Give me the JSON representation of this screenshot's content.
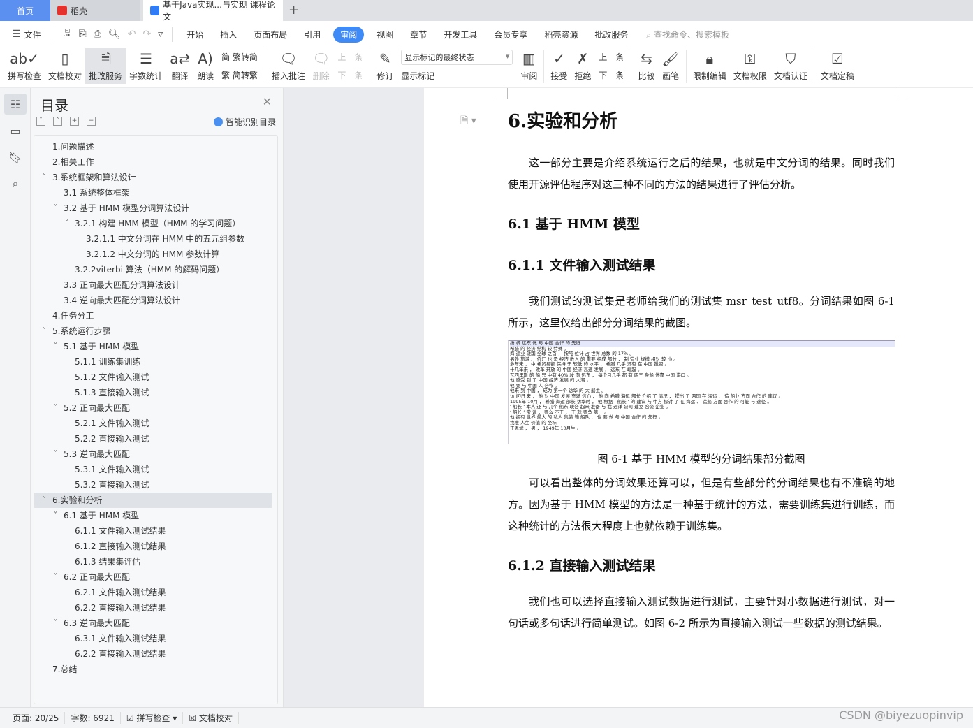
{
  "tabs": [
    {
      "label": "首页"
    },
    {
      "label": "稻壳"
    },
    {
      "label": "基于Java实现...与实现 课程论文"
    }
  ],
  "menu": {
    "file": "文件",
    "items": [
      "开始",
      "插入",
      "页面布局",
      "引用",
      "审阅",
      "视图",
      "章节",
      "开发工具",
      "会员专享",
      "稻壳资源",
      "批改服务"
    ],
    "active": "审阅",
    "search_placeholder": "查找命令、搜索模板"
  },
  "toolbar": {
    "spell": "拼写检查",
    "proof": "文档校对",
    "grade": "批改服务",
    "wordcount": "字数统计",
    "translate": "翻译",
    "read": "朗读",
    "t2s": "繁转简",
    "s2t": "简转繁",
    "insert_comment": "插入批注",
    "delete": "删除",
    "prev": "上一条",
    "next": "下一条",
    "track": "修订",
    "markup_state": "显示标记的最终状态",
    "show_markup": "显示标记",
    "review": "审阅",
    "accept": "接受",
    "reject": "拒绝",
    "prev2": "上一条",
    "next2": "下一条",
    "compare": "比较",
    "pen": "画笔",
    "restrict": "限制编辑",
    "permission": "文档权限",
    "certify": "文档认证",
    "finalize": "文档定稿"
  },
  "toc": {
    "title": "目录",
    "smart": "智能识别目录",
    "items": [
      {
        "label": "1.问题描述",
        "level": 1,
        "chev": false
      },
      {
        "label": "2.相关工作",
        "level": 1,
        "chev": false
      },
      {
        "label": "3.系统框架和算法设计",
        "level": 1,
        "chev": true
      },
      {
        "label": "3.1 系统整体框架",
        "level": 2,
        "chev": false
      },
      {
        "label": "3.2 基于 HMM 模型分词算法设计",
        "level": 2,
        "chev": true
      },
      {
        "label": "3.2.1 构建 HMM 模型（HMM 的学习问题）",
        "level": 3,
        "chev": true
      },
      {
        "label": "3.2.1.1 中文分词在 HMM 中的五元组参数",
        "level": 4,
        "chev": false
      },
      {
        "label": "3.2.1.2 中文分词的 HMM 参数计算",
        "level": 4,
        "chev": false
      },
      {
        "label": "3.2.2viterbi 算法（HMM 的解码问题）",
        "level": 3,
        "chev": false
      },
      {
        "label": "3.3 正向最大匹配分词算法设计",
        "level": 2,
        "chev": false
      },
      {
        "label": "3.4 逆向最大匹配分词算法设计",
        "level": 2,
        "chev": false
      },
      {
        "label": "4.任务分工",
        "level": 1,
        "chev": false
      },
      {
        "label": "5.系统运行步骤",
        "level": 1,
        "chev": true
      },
      {
        "label": "5.1 基于 HMM 模型",
        "level": 2,
        "chev": true
      },
      {
        "label": "5.1.1 训练集训练",
        "level": 3,
        "chev": false
      },
      {
        "label": "5.1.2 文件输入测试",
        "level": 3,
        "chev": false
      },
      {
        "label": "5.1.3 直接输入测试",
        "level": 3,
        "chev": false
      },
      {
        "label": "5.2 正向最大匹配",
        "level": 2,
        "chev": true
      },
      {
        "label": "5.2.1 文件输入测试",
        "level": 3,
        "chev": false
      },
      {
        "label": "5.2.2 直接输入测试",
        "level": 3,
        "chev": false
      },
      {
        "label": "5.3 逆向最大匹配",
        "level": 2,
        "chev": true
      },
      {
        "label": "5.3.1 文件输入测试",
        "level": 3,
        "chev": false
      },
      {
        "label": "5.3.2 直接输入测试",
        "level": 3,
        "chev": false
      },
      {
        "label": "6.实验和分析",
        "level": 1,
        "chev": true,
        "selected": true
      },
      {
        "label": "6.1 基于 HMM 模型",
        "level": 2,
        "chev": true
      },
      {
        "label": "6.1.1 文件输入测试结果",
        "level": 3,
        "chev": false
      },
      {
        "label": "6.1.2 直接输入测试结果",
        "level": 3,
        "chev": false
      },
      {
        "label": "6.1.3 结果集评估",
        "level": 3,
        "chev": false
      },
      {
        "label": "6.2 正向最大匹配",
        "level": 2,
        "chev": true
      },
      {
        "label": "6.2.1 文件输入测试结果",
        "level": 3,
        "chev": false
      },
      {
        "label": "6.2.2 直接输入测试结果",
        "level": 3,
        "chev": false
      },
      {
        "label": "6.3 逆向最大匹配",
        "level": 2,
        "chev": true
      },
      {
        "label": "6.3.1 文件输入测试结果",
        "level": 3,
        "chev": false
      },
      {
        "label": "6.2.2 直接输入测试结果",
        "level": 3,
        "chev": false
      },
      {
        "label": "7.总结",
        "level": 1,
        "chev": false
      }
    ]
  },
  "doc": {
    "h1": "6.实验和分析",
    "p1": "这一部分主要是介绍系统运行之后的结果，也就是中文分词的结果。同时我们使用开源评估程序对这三种不同的方法的结果进行了评估分析。",
    "h2a": "6.1 基于 HMM 模型",
    "h3a": "6.1.1 文件输入测试结果",
    "p2": "我们测试的测试集是老师给我们的测试集 msr_test_utf8。分词结果如图 6-1 所示，这里仅给出部分分词结果的截图。",
    "shot_lines": [
      "扬 帆 远东 做 与 中国 合作 的 先行",
      "希腊 的 经济 结构 较 特殊 。",
      "海 运业 雄踞 全球 之首 ， 按吨 位计 占 世界 总数 的 17% 。",
      "另外 旅游 、 侨汇 也 是 经济 收入 的 重要 组成 部分 ， 制 造业 规模 相对 较 小 。",
      "多年来 ， 中 希贸易额 保持 于 较低 的 水平 ， 希腊 几乎 没有 在 中国 投资 。",
      "十几年来 ， 改革 开放 的 中国 经济 高速 发展 ， 远东 在 崛起 。",
      "瓦西里斯 的 船 只 中有 40% 驶 向 远东 ， 每个月几乎 都 有 两三 条船 停靠 中国 港口 。",
      "他 感受 到 了 中国 经济 发展 的 大潮 。",
      "他 要 与 中国 人 合作 。",
      "他来 到 中国 ， 成为 第一个 访华 的 大 船主 。",
      "访 问归 来 ， 他 对 中国 发展 充满 信心 ， 他 向 希腊 海运 部长 介绍 了 情况 ， 提出 了 两国 在 海运 、 造 船业 方面 合作 的 建议 。",
      "1995年 10月 ， 希腊 海运 部长 访华时 ， 他 根据 ‘ 船长 ’ 的 建议 与 中方 探讨 了 在 海运 、 造船 方面 合作 的 可能 与 途径 。",
      "‘ 船长 ’ 本人 还 与 几个 船东 联合 起来 准备 与 我 远洋 公司 建立 合资 企业 。",
      "‘ 船长 ’ 常 说 ， 要么 不干 ， 干 就 要争 第一 。",
      "他 拥有 世界 最大 的 私人 集装 箱 船队 ， 也 要 做 与 中国 合作 的 先行 。",
      "找准 人生 价值 的 坐标",
      "王恩斌 ， 男 ， 1949年 10月生 。"
    ],
    "caption": "图 6-1  基于 HMM 模型的分词结果部分截图",
    "p3": "可以看出整体的分词效果还算可以，但是有些部分的分词结果也有不准确的地方。因为基于 HMM 模型的方法是一种基于统计的方法，需要训练集进行训练，而这种统计的方法很大程度上也就依赖于训练集。",
    "h3b": "6.1.2 直接输入测试结果",
    "p4": "我们也可以选择直接输入测试数据进行测试，主要针对小数据进行测试，对一句话或多句话进行简单测试。如图 6-2 所示为直接输入测试一些数据的测试结果。"
  },
  "status": {
    "page": "页面: 20/25",
    "words": "字数: 6921",
    "spell": "拼写检查",
    "proof": "文档校对"
  },
  "watermark": "CSDN @biyezuopinvip",
  "colors": {
    "accent": "#3e8af7",
    "home_tab": "#5b8ff0"
  }
}
